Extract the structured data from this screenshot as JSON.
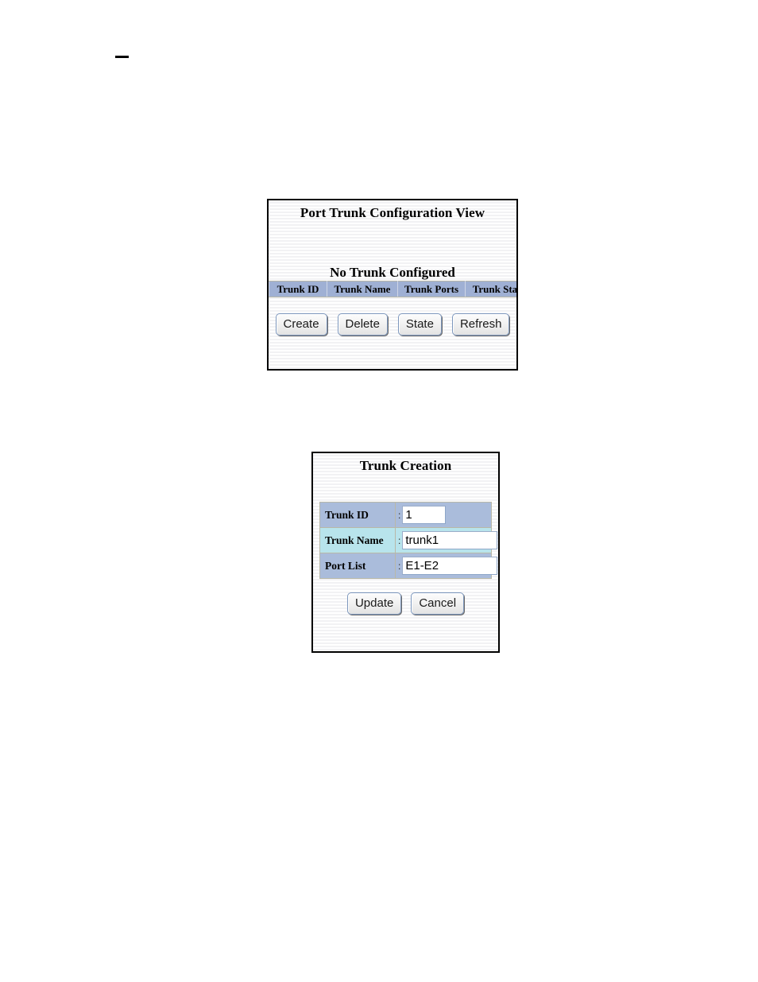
{
  "page": {
    "background": "#ffffff",
    "dash_mark": "—"
  },
  "colors": {
    "header_blue": "#9fb0d4",
    "row_blue": "#aabcdb",
    "row_cyan": "#b8e4ec",
    "panel_border": "#000000",
    "button_face": "#efefef",
    "button_border": "#7d97bd",
    "cell_border": "#b9b8a8"
  },
  "trunk_view_panel": {
    "title": "Port Trunk Configuration View",
    "status_message": "No Trunk Configured",
    "table": {
      "columns": [
        "Trunk ID",
        "Trunk Name",
        "Trunk Ports",
        "Trunk State"
      ],
      "rows": []
    },
    "buttons": [
      {
        "label": "Create"
      },
      {
        "label": "Delete"
      },
      {
        "label": "State"
      },
      {
        "label": "Refresh"
      }
    ]
  },
  "trunk_creation_panel": {
    "title": "Trunk Creation",
    "separator": ":",
    "fields": [
      {
        "label": "Trunk ID",
        "value": "1",
        "placeholder": "",
        "tone": "blue"
      },
      {
        "label": "Trunk Name",
        "value": "trunk1",
        "placeholder": "",
        "tone": "cyan"
      },
      {
        "label": "Port List",
        "value": "E1-E2",
        "placeholder": "",
        "tone": "blue"
      }
    ],
    "buttons": [
      {
        "label": "Update"
      },
      {
        "label": "Cancel"
      }
    ]
  }
}
